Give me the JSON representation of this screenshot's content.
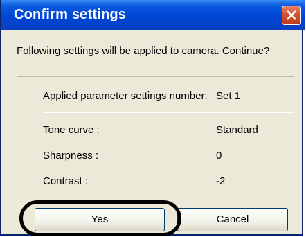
{
  "dialog": {
    "title": "Confirm settings",
    "message": "Following settings will be applied to camera. Continue?"
  },
  "settings": {
    "set_label": "Applied parameter settings number:",
    "set_value": "Set 1",
    "items": [
      {
        "label": "Tone curve :",
        "value": "Standard"
      },
      {
        "label": "Sharpness :",
        "value": "0"
      },
      {
        "label": "Contrast :",
        "value": "-2"
      }
    ]
  },
  "buttons": {
    "yes": "Yes",
    "cancel": "Cancel"
  },
  "icons": {
    "close": "close-icon"
  },
  "colors": {
    "titlebar": "#0046d5",
    "close_button": "#d5522f",
    "dialog_background": "#ece9d8"
  }
}
